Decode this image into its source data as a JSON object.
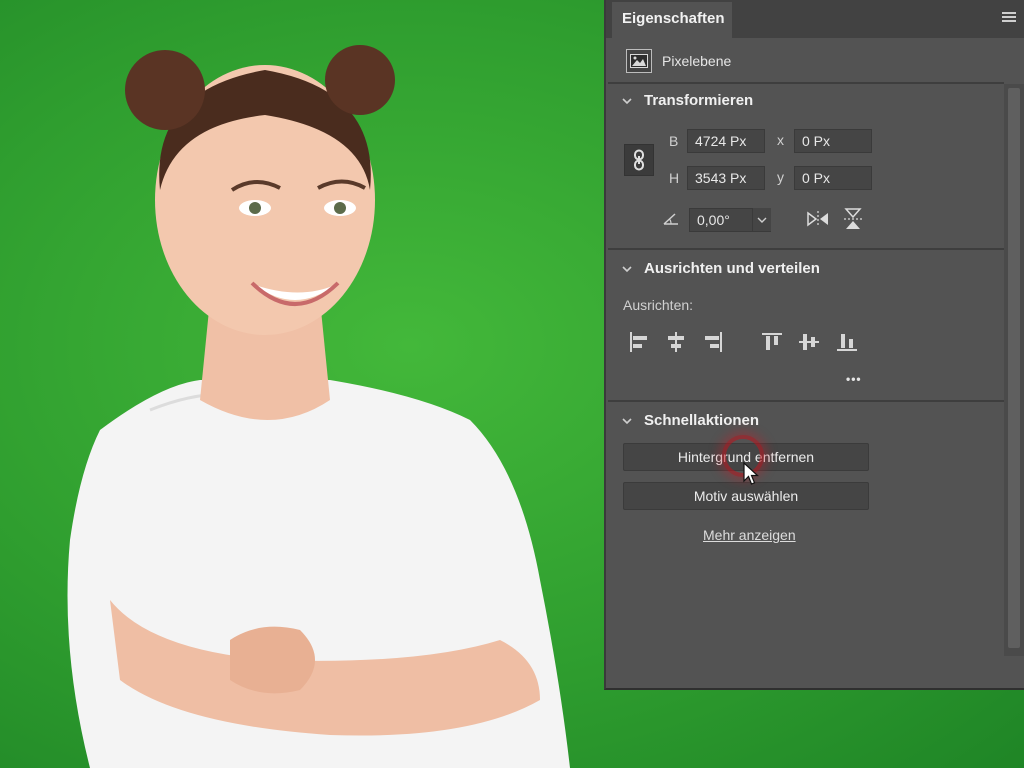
{
  "panel": {
    "tab_title": "Eigenschaften",
    "layer_kind_label": "Pixelebene"
  },
  "transform": {
    "section_title": "Transformieren",
    "width_label": "B",
    "width_value": "4724 Px",
    "height_label": "H",
    "height_value": "3543 Px",
    "x_label": "x",
    "x_value": "0 Px",
    "y_label": "y",
    "y_value": "0 Px",
    "angle_value": "0,00°"
  },
  "align": {
    "section_title": "Ausrichten und verteilen",
    "label": "Ausrichten:",
    "more_glyph": "•••"
  },
  "quick_actions": {
    "section_title": "Schnellaktionen",
    "remove_background_label": "Hintergrund entfernen",
    "select_subject_label": "Motiv auswählen",
    "show_more_label": "Mehr anzeigen"
  },
  "colors": {
    "background_green": "#34a333",
    "panel": "#535353",
    "field": "#454545",
    "highlight_ring": "#be141e"
  }
}
